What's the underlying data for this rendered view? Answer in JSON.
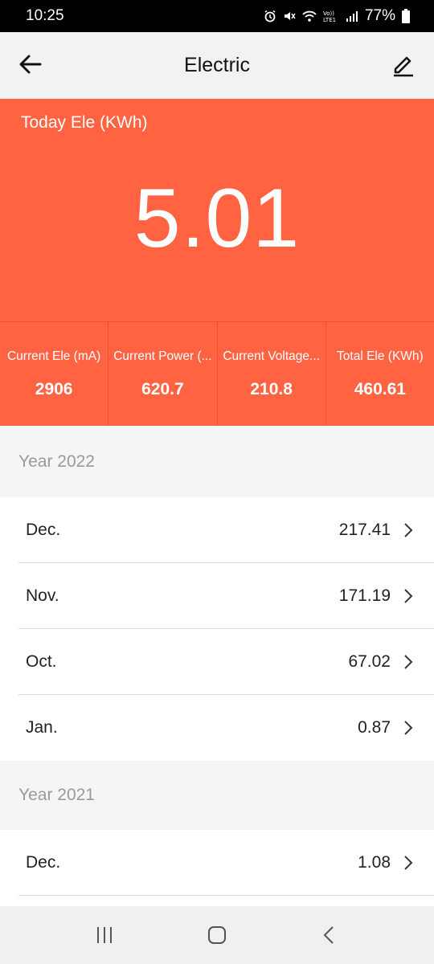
{
  "status_bar": {
    "time": "10:25",
    "battery": "77%",
    "icons": [
      "alarm-icon",
      "mute-icon",
      "wifi-icon",
      "volte-icon",
      "signal-icon",
      "battery-icon"
    ]
  },
  "header": {
    "title": "Electric",
    "back_icon": "back-arrow-icon",
    "edit_icon": "edit-pencil-icon"
  },
  "hero": {
    "label": "Today Ele (KWh)",
    "value": "5.01"
  },
  "stats": [
    {
      "label": "Current Ele (mA)",
      "value": "2906"
    },
    {
      "label": "Current Power (...",
      "value": "620.7"
    },
    {
      "label": "Current Voltage...",
      "value": "210.8"
    },
    {
      "label": "Total Ele (KWh)",
      "value": "460.61"
    }
  ],
  "years": [
    {
      "year": "Year 2022",
      "months": [
        {
          "month": "Dec.",
          "value": "217.41"
        },
        {
          "month": "Nov.",
          "value": "171.19"
        },
        {
          "month": "Oct.",
          "value": "67.02"
        },
        {
          "month": "Jan.",
          "value": "0.87"
        }
      ]
    },
    {
      "year": "Year 2021",
      "months": [
        {
          "month": "Dec.",
          "value": "1.08"
        }
      ]
    }
  ],
  "colors": {
    "accent": "#ff6342",
    "background": "#f5f5f5"
  }
}
